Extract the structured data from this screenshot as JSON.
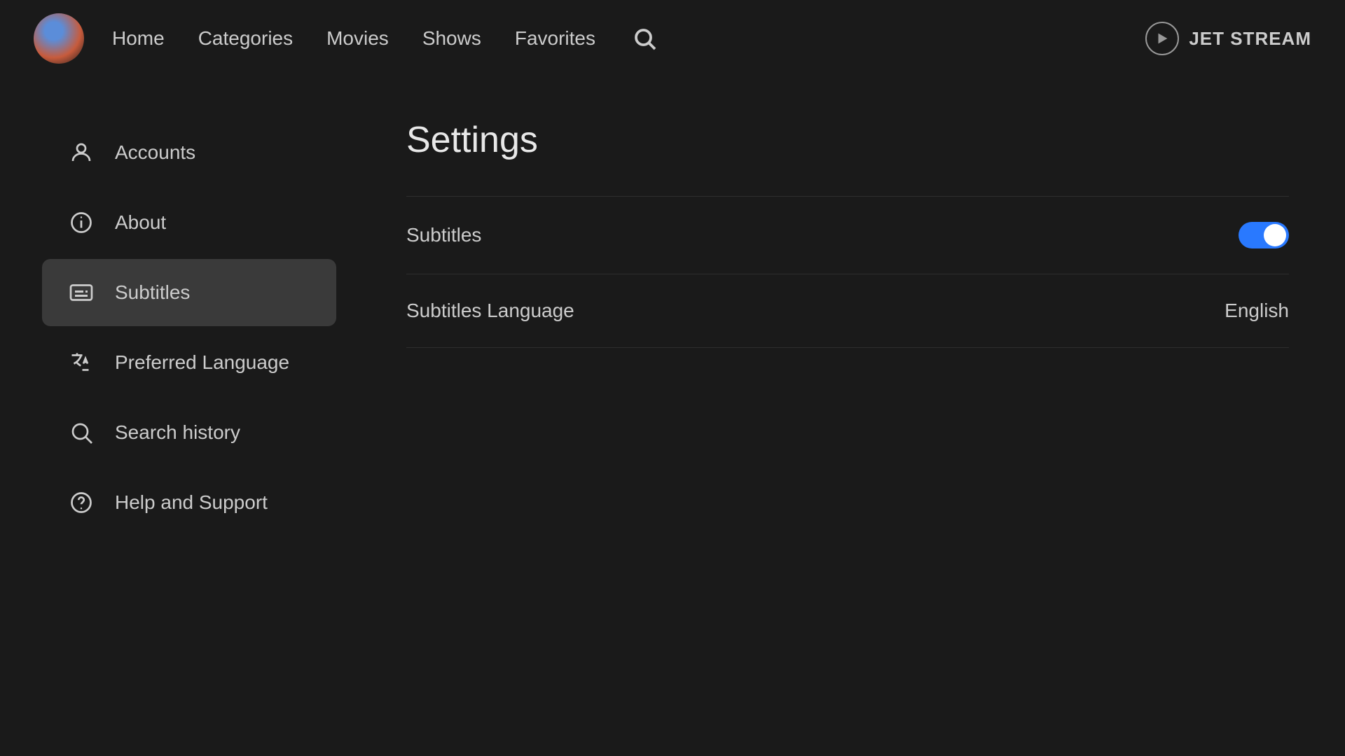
{
  "brand": {
    "name": "JET STREAM"
  },
  "nav": {
    "links": [
      {
        "label": "Home",
        "id": "home"
      },
      {
        "label": "Categories",
        "id": "categories"
      },
      {
        "label": "Movies",
        "id": "movies"
      },
      {
        "label": "Shows",
        "id": "shows"
      },
      {
        "label": "Favorites",
        "id": "favorites"
      }
    ]
  },
  "sidebar": {
    "items": [
      {
        "id": "accounts",
        "label": "Accounts",
        "icon": "user-icon",
        "active": false
      },
      {
        "id": "about",
        "label": "About",
        "icon": "info-icon",
        "active": false
      },
      {
        "id": "subtitles",
        "label": "Subtitles",
        "icon": "subtitles-icon",
        "active": true
      },
      {
        "id": "preferred-language",
        "label": "Preferred Language",
        "icon": "translate-icon",
        "active": false
      },
      {
        "id": "search-history",
        "label": "Search history",
        "icon": "search-icon",
        "active": false
      },
      {
        "id": "help-support",
        "label": "Help and Support",
        "icon": "help-icon",
        "active": false
      }
    ]
  },
  "settings": {
    "title": "Settings",
    "rows": [
      {
        "id": "subtitles-toggle",
        "label": "Subtitles",
        "type": "toggle",
        "value": true
      },
      {
        "id": "subtitles-language",
        "label": "Subtitles Language",
        "type": "value",
        "value": "English"
      }
    ]
  }
}
